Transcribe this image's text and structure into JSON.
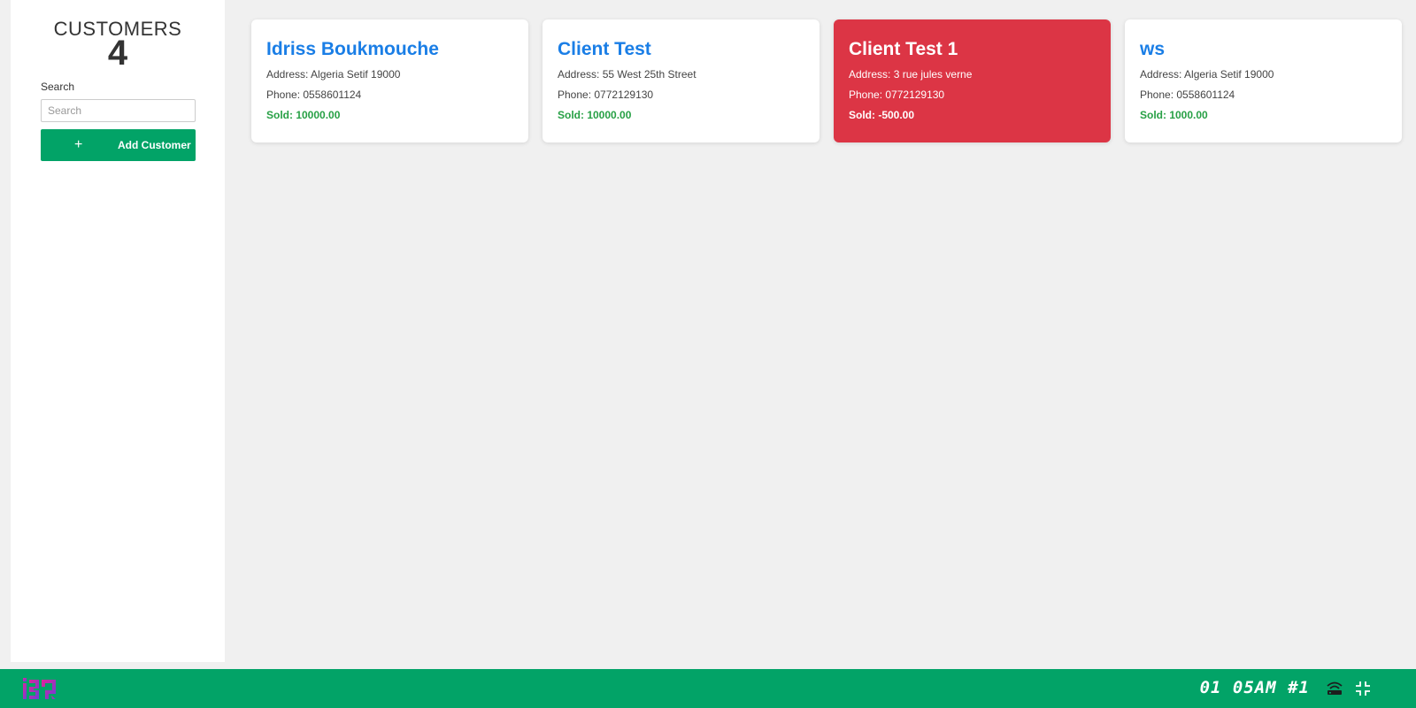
{
  "sidebar": {
    "title": "CUSTOMERS",
    "count": "4",
    "search_label": "Search",
    "search_placeholder": "Search",
    "search_value": "",
    "add_icon": "plus-icon",
    "add_button_label": "Add Customer"
  },
  "customers": [
    {
      "name": "Idriss Boukmouche",
      "address": "Address: Algeria Setif 19000",
      "phone": "Phone: 0558601124",
      "sold": "Sold: 10000.00"
    },
    {
      "name": "Client Test",
      "address": "Address: 55 West 25th Street",
      "phone": "Phone: 0772129130",
      "sold": "Sold: 10000.00"
    },
    {
      "name": "Client Test 1",
      "address": "Address: 3 rue jules verne",
      "phone": "Phone: 0772129130",
      "sold": "Sold: -500.00",
      "negative": true
    },
    {
      "name": "ws",
      "address": "Address: Algeria Setif 19000",
      "phone": "Phone: 0558601124",
      "sold": "Sold: 1000.00"
    }
  ],
  "taskbar": {
    "clock": "01 05AM #1",
    "icons": [
      "app-logo-icon",
      "network-icon",
      "collapse-icon"
    ]
  },
  "colors": {
    "accent_green": "#02a367",
    "name_blue": "#1a7ee6",
    "sold_green": "#27a045",
    "negative_red": "#dc3545"
  }
}
